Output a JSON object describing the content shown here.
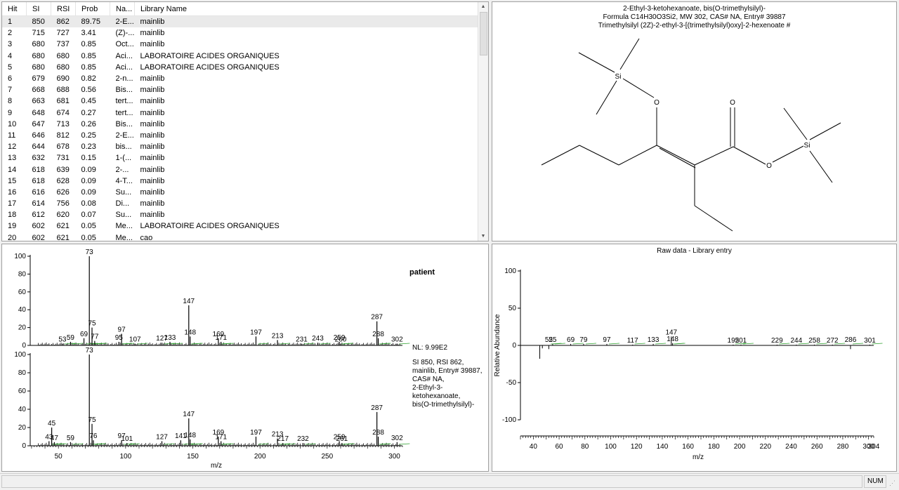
{
  "hit_list": {
    "columns": [
      "Hit",
      "SI",
      "RSI",
      "Prob",
      "Na...",
      "Library Name"
    ],
    "rows": [
      [
        "1",
        "850",
        "862",
        "89.75",
        "2-E...",
        "mainlib"
      ],
      [
        "2",
        "715",
        "727",
        "3.41",
        "(Z)-...",
        "mainlib"
      ],
      [
        "3",
        "680",
        "737",
        "0.85",
        "Oct...",
        "mainlib"
      ],
      [
        "4",
        "680",
        "680",
        "0.85",
        "Aci...",
        "LABORATOIRE ACIDES ORGANIQUES"
      ],
      [
        "5",
        "680",
        "680",
        "0.85",
        "Aci...",
        "LABORATOIRE ACIDES ORGANIQUES"
      ],
      [
        "6",
        "679",
        "690",
        "0.82",
        "2-n...",
        "mainlib"
      ],
      [
        "7",
        "668",
        "688",
        "0.56",
        "Bis...",
        "mainlib"
      ],
      [
        "8",
        "663",
        "681",
        "0.45",
        "tert...",
        "mainlib"
      ],
      [
        "9",
        "648",
        "674",
        "0.27",
        "tert...",
        "mainlib"
      ],
      [
        "10",
        "647",
        "713",
        "0.26",
        "Bis...",
        "mainlib"
      ],
      [
        "11",
        "646",
        "812",
        "0.25",
        "2-E...",
        "mainlib"
      ],
      [
        "12",
        "644",
        "678",
        "0.23",
        "bis...",
        "mainlib"
      ],
      [
        "13",
        "632",
        "731",
        "0.15",
        "1-(...",
        "mainlib"
      ],
      [
        "14",
        "618",
        "639",
        "0.09",
        "2-...",
        "mainlib"
      ],
      [
        "15",
        "618",
        "628",
        "0.09",
        "4-T...",
        "mainlib"
      ],
      [
        "16",
        "616",
        "626",
        "0.09",
        "Su...",
        "mainlib"
      ],
      [
        "17",
        "614",
        "756",
        "0.08",
        "Di...",
        "mainlib"
      ],
      [
        "18",
        "612",
        "620",
        "0.07",
        "Su...",
        "mainlib"
      ],
      [
        "19",
        "602",
        "621",
        "0.05",
        "Me...",
        "LABORATOIRE ACIDES ORGANIQUES"
      ],
      [
        "20",
        "602",
        "621",
        "0.05",
        "Me...",
        "cao"
      ]
    ]
  },
  "structure": {
    "title_lines": [
      "2-Ethyl-3-ketohexanoate, bis(O-trimethylsilyl)-",
      "Formula C14H30O3Si2, MW 302, CAS# NA, Entry# 39887",
      "Trimethylsilyl (2Z)-2-ethyl-3-[(trimethylsilyl)oxy]-2-hexenoate  #"
    ],
    "atoms": {
      "si_top": "Si",
      "o_top": "O",
      "o_carbonyl": "O",
      "o_ester": "O",
      "si_right": "Si"
    }
  },
  "spectra": {
    "y_ticks": [
      "100",
      "80",
      "60",
      "40",
      "20",
      "0"
    ],
    "x_ticks": [
      "50",
      "100",
      "150",
      "200",
      "250",
      "300"
    ],
    "x_label": "m/z",
    "sample_label": "patient",
    "info_lines": [
      "NL: 9.99E2",
      "SI 850, RSI 862,",
      "mainlib, Entry# 39887,",
      "CAS# NA,",
      "2-Ethyl-3-",
      "ketohexanoate,",
      "bis(O-trimethylsilyl)-"
    ],
    "upper_labels": [
      "73",
      "53",
      "59",
      "69",
      "75",
      "77",
      "95",
      "97",
      "107",
      "127",
      "133",
      "147",
      "148",
      "169",
      "171",
      "197",
      "213",
      "231",
      "243",
      "259",
      "260",
      "287",
      "288",
      "302"
    ],
    "lower_labels": [
      "73",
      "43",
      "45",
      "47",
      "59",
      "75",
      "76",
      "97",
      "101",
      "127",
      "141",
      "147",
      "148",
      "169",
      "171",
      "197",
      "213",
      "217",
      "232",
      "259",
      "261",
      "287",
      "288",
      "302"
    ]
  },
  "raw": {
    "title": "Raw data - Library entry",
    "y_label": "Relative Abundance",
    "y_ticks": [
      "100",
      "50",
      "0",
      "-50",
      "-100"
    ],
    "x_ticks": [
      "40",
      "60",
      "80",
      "100",
      "120",
      "140",
      "160",
      "180",
      "200",
      "220",
      "240",
      "260",
      "280",
      "300"
    ],
    "x_extra": "304",
    "x_label": "m/z",
    "peak_labels": [
      "52",
      "55",
      "69",
      "79",
      "97",
      "117",
      "133",
      "147",
      "148",
      "195",
      "201",
      "229",
      "244",
      "258",
      "272",
      "286",
      "301"
    ]
  },
  "status": {
    "num": "NUM"
  },
  "colors": {
    "grid": "#e4e4e4",
    "selection": "#eaeaea",
    "peak": "#000000",
    "tick_marker": "#2ca02c"
  }
}
